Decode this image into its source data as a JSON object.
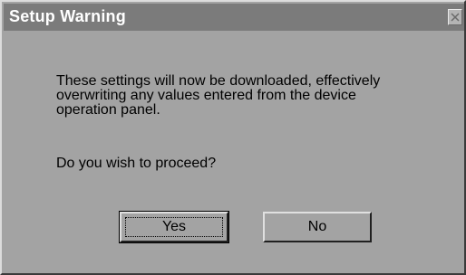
{
  "dialog": {
    "title": "Setup Warning",
    "close_icon": "close-icon",
    "message_lines": [
      "These settings will now be downloaded, effectively",
      "overwriting any values entered from the device",
      "operation panel."
    ],
    "question": "Do you wish to proceed?",
    "buttons": {
      "yes_label": "Yes",
      "no_label": "No"
    }
  },
  "colors": {
    "titlebar": "#7b7b7b",
    "title_text": "#ffffff",
    "background": "#a3a3a3"
  }
}
